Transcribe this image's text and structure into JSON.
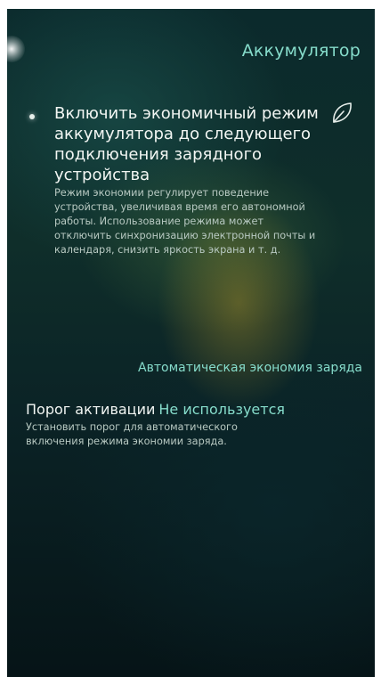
{
  "header": {
    "title": "Аккумулятор"
  },
  "battery_saver": {
    "title": "Включить экономичный режим аккумулятора до следующего подключения зарядного устройства",
    "description": "Режим экономии регулирует поведение устройства, увеличивая время его автономной работы. Использование режима может отключить синхронизацию электронной почты и календаря, снизить яркость экрана и т. д.",
    "icon": "leaf-icon"
  },
  "auto_saver": {
    "label": "Автоматическая экономия заряда"
  },
  "threshold": {
    "label": "Порог активации",
    "value": "Не используется",
    "description": "Установить порог для автоматического включения режима экономии заряда."
  },
  "colors": {
    "accent": "#86dccb",
    "text_primary": "#f2f6f3",
    "text_secondary": "#b8c9c2"
  }
}
